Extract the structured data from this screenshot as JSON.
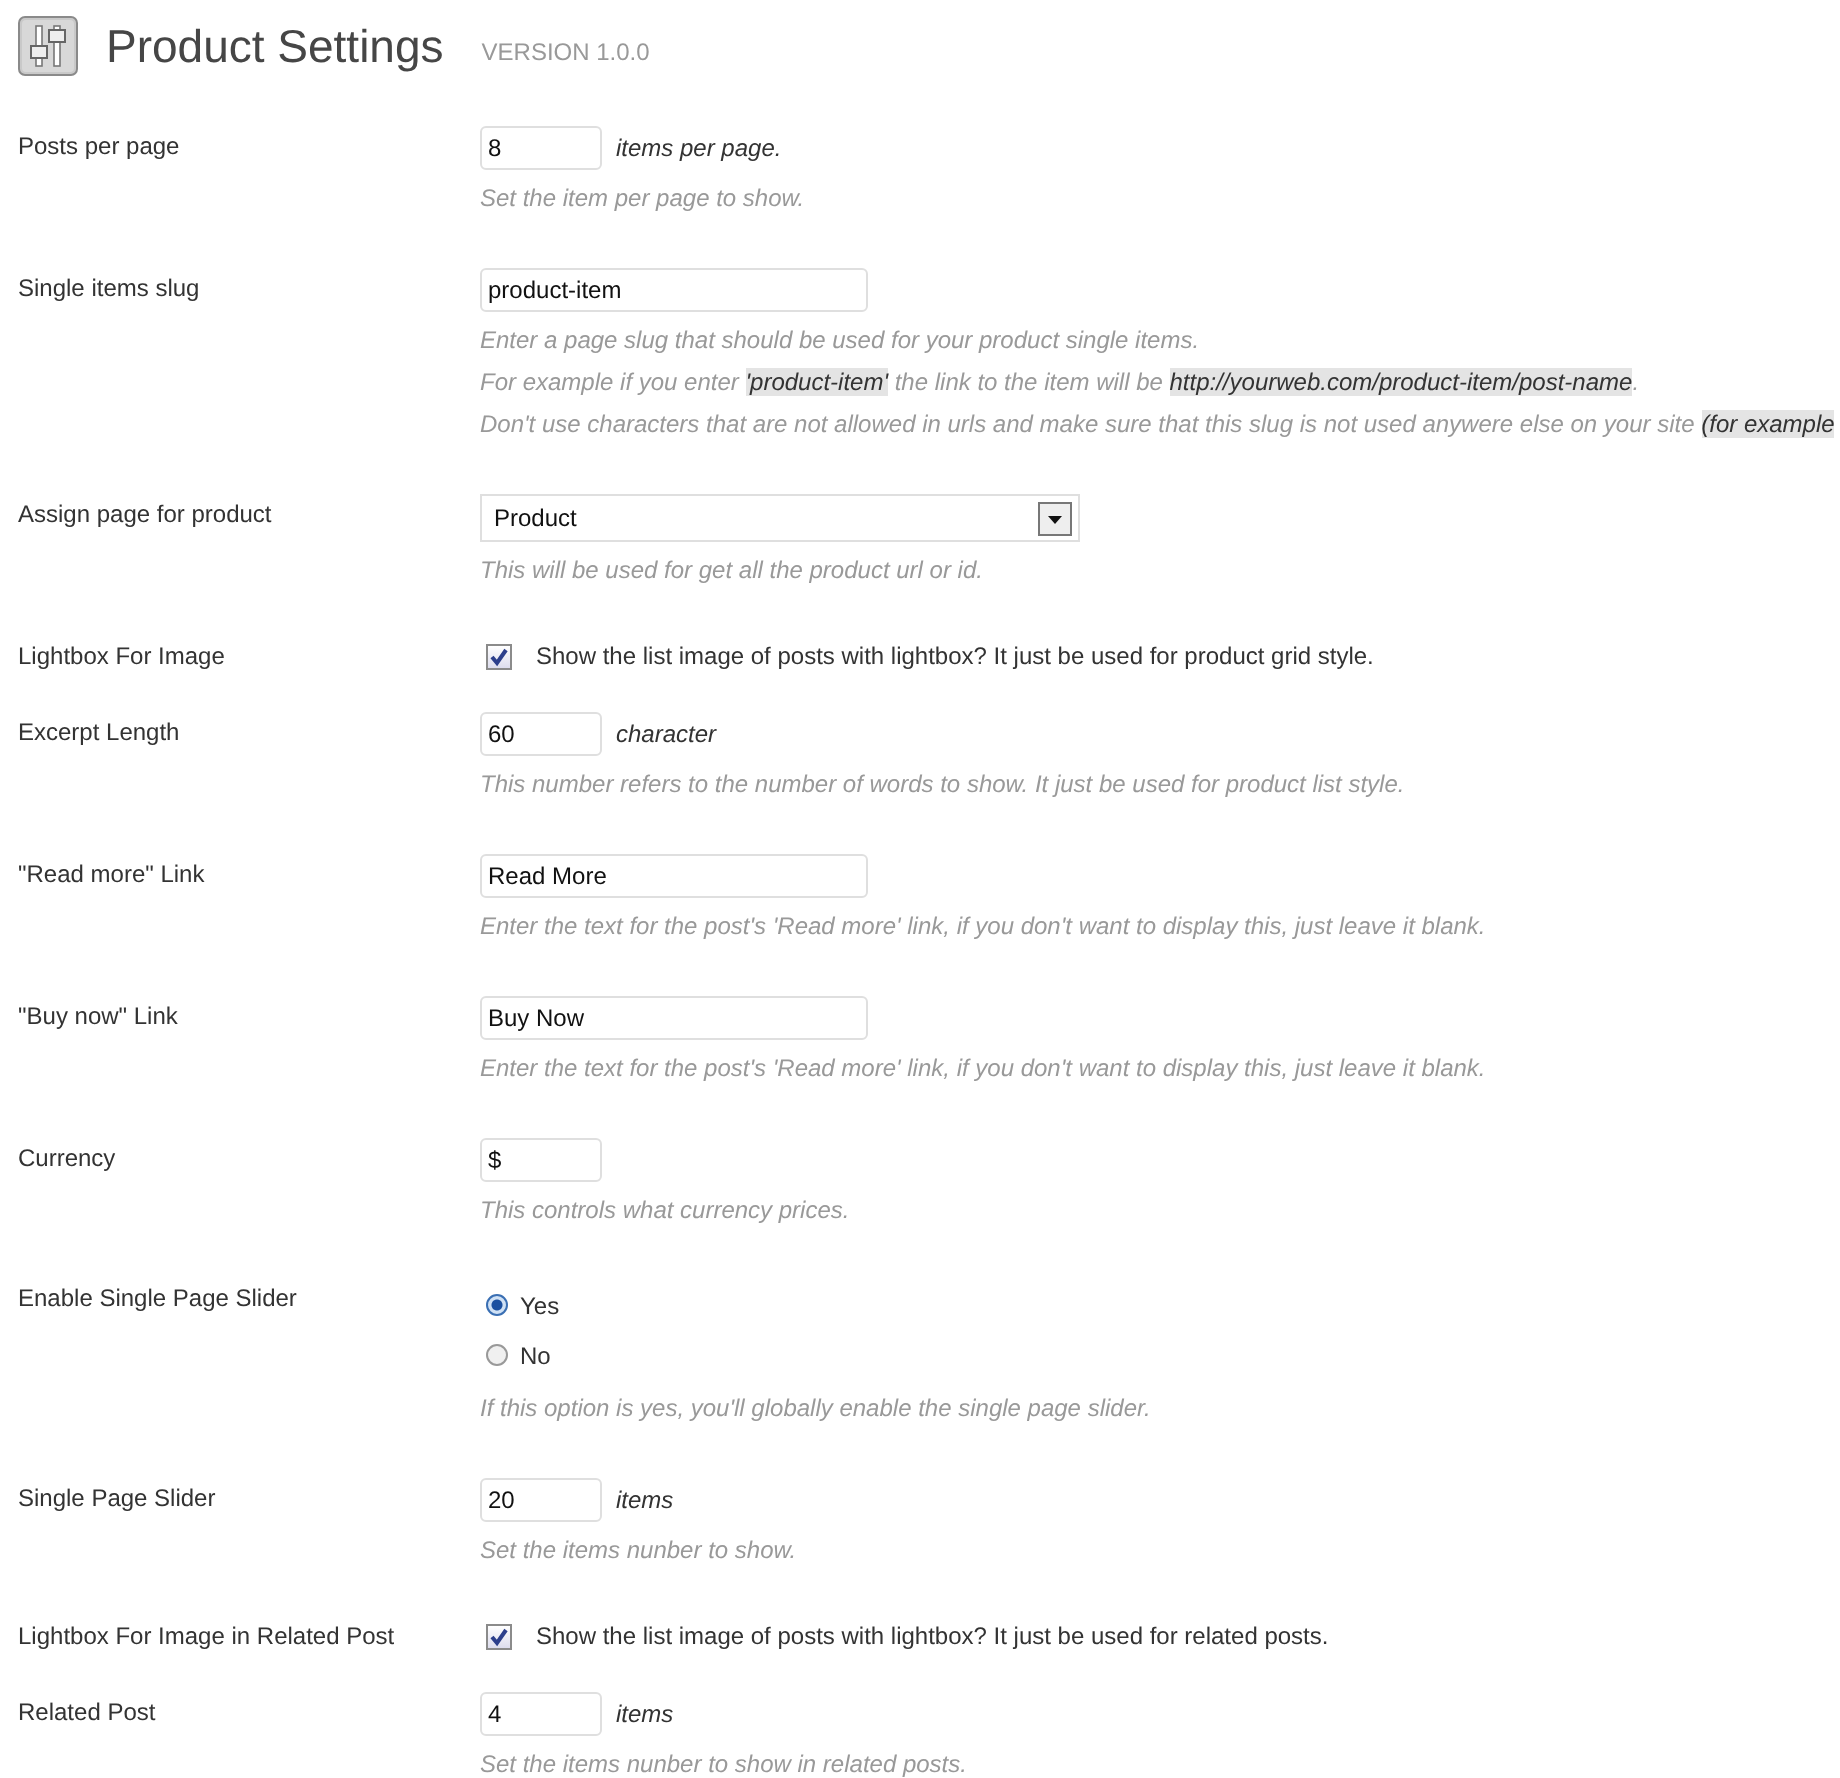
{
  "header": {
    "title": "Product Settings",
    "version": "VERSION 1.0.0"
  },
  "settings": [
    {
      "label": "Posts per page",
      "kind": "short_text",
      "value": "8",
      "suffix": "items per page.",
      "description": [
        [
          {
            "text": "Set the item per page to show.",
            "code": false
          }
        ]
      ]
    },
    {
      "label": "Single items slug",
      "kind": "text",
      "value": "product-item",
      "description": [
        [
          {
            "text": "Enter a page slug that should be used for your product single items.",
            "code": false
          }
        ],
        [
          {
            "text": "For example if you enter ",
            "code": false
          },
          {
            "text": "'product-item'",
            "code": true
          },
          {
            "text": " the link to the item will be ",
            "code": false
          },
          {
            "text": "http://yourweb.com/product-item/post-name",
            "code": true
          },
          {
            "text": ".",
            "code": false
          }
        ],
        [
          {
            "text": "Don't use characters that are not allowed in urls and make sure that this slug is not used anywere else on your site ",
            "code": false
          },
          {
            "text": "(for example",
            "code": true
          }
        ]
      ]
    },
    {
      "label": "Assign page for product",
      "kind": "select",
      "value": "Product",
      "description": [
        [
          {
            "text": "This will be used for get all the product url or id.",
            "code": false
          }
        ]
      ]
    },
    {
      "label": "Lightbox For Image",
      "kind": "checkbox",
      "checked": true,
      "text": "Show the list image of posts with lightbox? It just be used for product grid style."
    },
    {
      "label": "Excerpt Length",
      "kind": "short_text",
      "value": "60",
      "suffix": "character",
      "description": [
        [
          {
            "text": "This number refers to the number of words to show. It just be used for product list style.",
            "code": false
          }
        ]
      ]
    },
    {
      "label": "\"Read more\" Link",
      "kind": "text",
      "value": "Read More",
      "description": [
        [
          {
            "text": "Enter the text for the post's 'Read more' link, if you don't want to display this, just leave it blank.",
            "code": false
          }
        ]
      ]
    },
    {
      "label": "\"Buy now\" Link",
      "kind": "text",
      "value": "Buy Now",
      "description": [
        [
          {
            "text": "Enter the text for the post's 'Read more' link, if you don't want to display this, just leave it blank.",
            "code": false
          }
        ]
      ]
    },
    {
      "label": "Currency",
      "kind": "short_text",
      "value": "$",
      "description": [
        [
          {
            "text": "This controls what currency prices.",
            "code": false
          }
        ]
      ]
    },
    {
      "label": "Enable Single Page Slider",
      "kind": "radio",
      "options": [
        {
          "label": "Yes",
          "selected": true
        },
        {
          "label": "No",
          "selected": false
        }
      ],
      "description": [
        [
          {
            "text": "If this option is yes, you'll globally enable the single page slider.",
            "code": false
          }
        ]
      ]
    },
    {
      "label": "Single Page Slider",
      "kind": "short_text",
      "value": "20",
      "suffix": "items",
      "description": [
        [
          {
            "text": "Set the items nunber to show.",
            "code": false
          }
        ]
      ]
    },
    {
      "label": "Lightbox For Image in Related Post",
      "kind": "checkbox",
      "checked": true,
      "text": "Show the list image of posts with lightbox? It just be used for related posts."
    },
    {
      "label": "Related Post",
      "kind": "short_text",
      "value": "4",
      "suffix": "items",
      "description": [
        [
          {
            "text": "Set the items nunber to show in related posts.",
            "code": false
          }
        ]
      ]
    }
  ]
}
